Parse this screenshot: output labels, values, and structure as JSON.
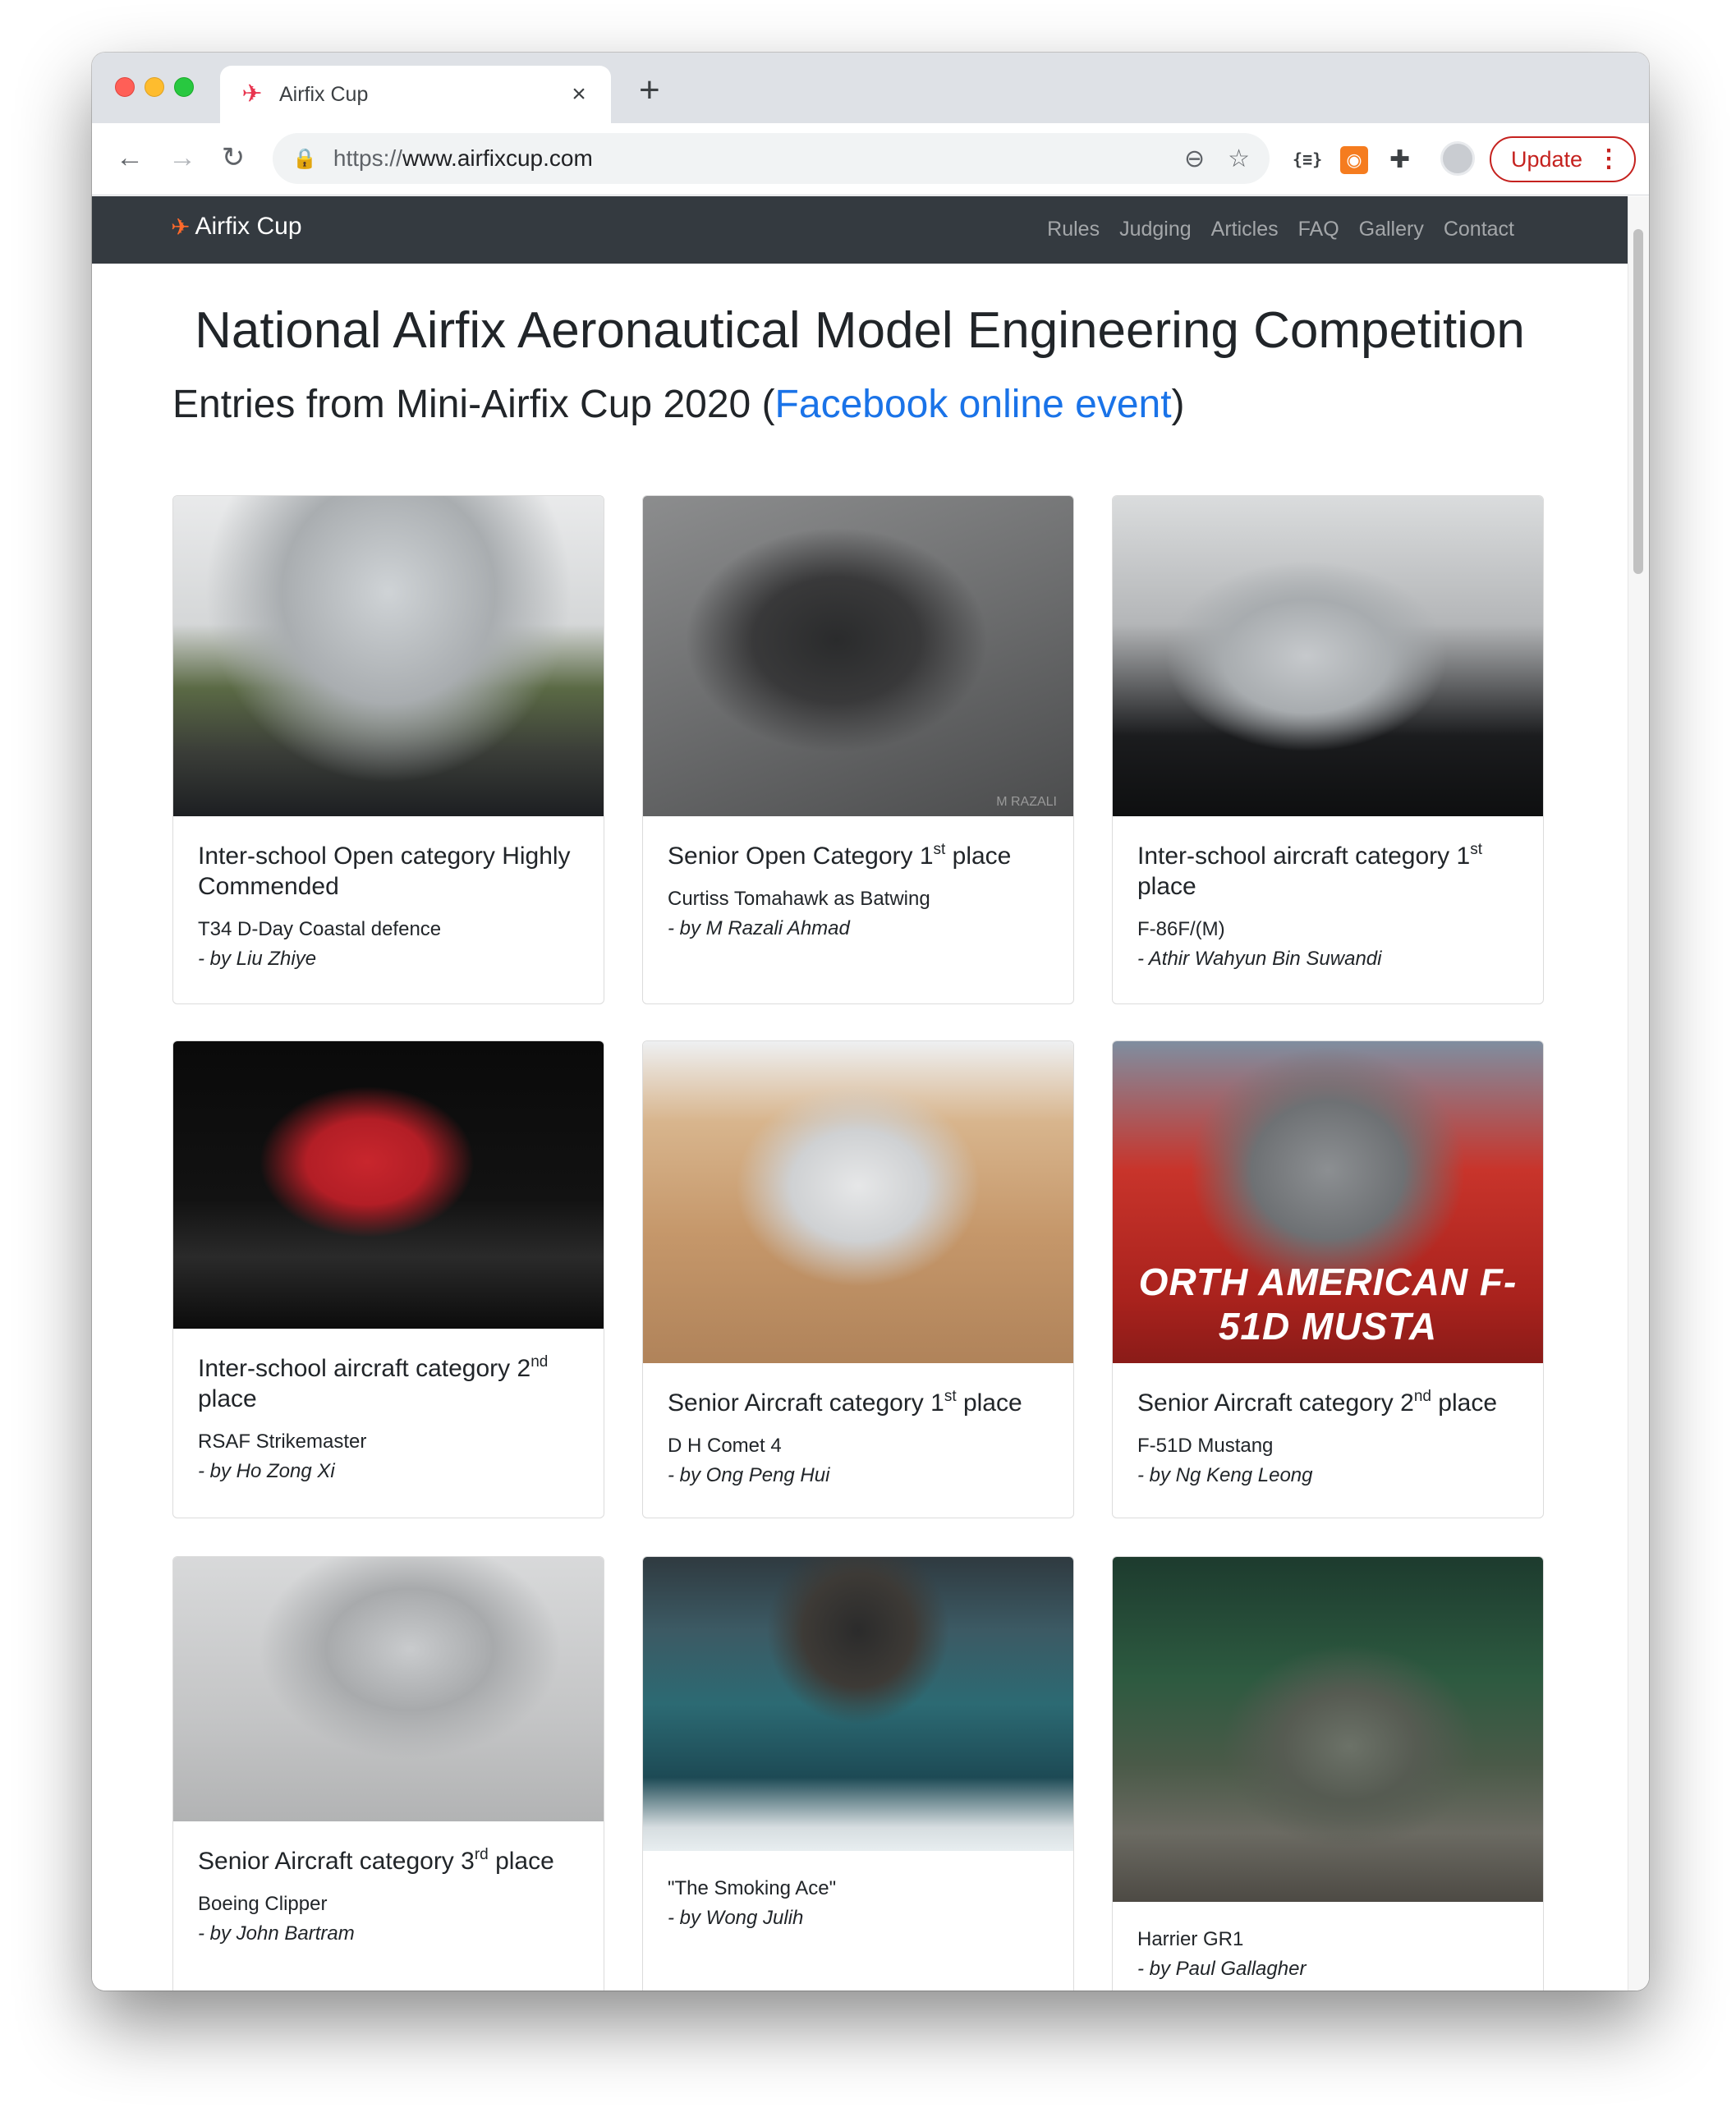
{
  "browser": {
    "tab_title": "Airfix Cup",
    "tab_icon": "plane-icon",
    "url_scheme": "https://",
    "url_host": "www.airfixcup.com",
    "update_label": "Update"
  },
  "navbar": {
    "brand": "Airfix Cup",
    "links": [
      "Rules",
      "Judging",
      "Articles",
      "FAQ",
      "Gallery",
      "Contact"
    ]
  },
  "page": {
    "heading": "National Airfix Aeronautical Model Engineering Competition",
    "subheading_prefix": "Entries from Mini-Airfix Cup 2020 (",
    "subheading_link": "Facebook online event",
    "subheading_suffix": ")"
  },
  "cards": [
    {
      "title_pre": "Inter-school Open category Highly Commended",
      "sup": "",
      "title_post": "",
      "model": "T34 D-Day Coastal defence",
      "by": "- by Liu Zhiye"
    },
    {
      "title_pre": "Senior Open Category 1",
      "sup": "st",
      "title_post": " place",
      "model": "Curtiss Tomahawk as Batwing",
      "by": "- by M Razali Ahmad",
      "watermark": "M RAZALI"
    },
    {
      "title_pre": "Inter-school aircraft category 1",
      "sup": "st",
      "title_post": " place",
      "model": "F-86F/(M)",
      "by": "- Athir Wahyun Bin Suwandi"
    },
    {
      "title_pre": "Inter-school aircraft category 2",
      "sup": "nd",
      "title_post": " place",
      "model": "RSAF Strikemaster",
      "by": "- by Ho Zong Xi"
    },
    {
      "title_pre": "Senior Aircraft category 1",
      "sup": "st",
      "title_post": " place",
      "model": "D H Comet 4",
      "by": "- by Ong Peng Hui"
    },
    {
      "title_pre": "Senior Aircraft category 2",
      "sup": "nd",
      "title_post": " place",
      "model": "F-51D Mustang",
      "by": "- by Ng Keng Leong",
      "box_text": "ORTH AMERICAN F-51D MUSTA"
    },
    {
      "title_pre": "Senior Aircraft category 3",
      "sup": "rd",
      "title_post": " place",
      "model": "Boeing Clipper",
      "by": "- by John Bartram"
    },
    {
      "title_pre": "",
      "sup": "",
      "title_post": "",
      "model": "\"The Smoking Ace\"",
      "by": "- by Wong Julih"
    },
    {
      "title_pre": "",
      "sup": "",
      "title_post": "",
      "model": "Harrier GR1",
      "by": "- by Paul Gallagher"
    }
  ]
}
